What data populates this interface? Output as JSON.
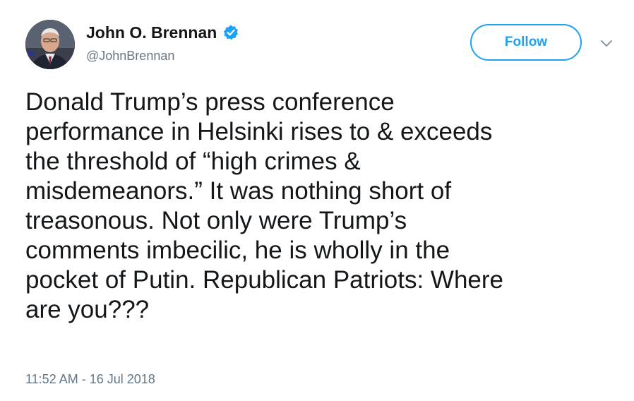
{
  "user": {
    "display_name": "John O. Brennan",
    "handle": "@JohnBrennan",
    "verified": true
  },
  "actions": {
    "follow_label": "Follow"
  },
  "tweet": {
    "lines": [
      "Donald Trump’s press conference",
      "performance in Helsinki rises to & exceeds",
      "the threshold of “high crimes &",
      "misdemeanors.” It was nothing short of",
      "treasonous. Not only were Trump’s",
      "comments imbecilic, he is wholly in the",
      "pocket of Putin. Republican Patriots: Where",
      "are you???"
    ],
    "timestamp": "11:52 AM - 16 Jul 2018"
  },
  "colors": {
    "accent": "#1da1f2",
    "text": "#14171a",
    "secondary": "#657786"
  },
  "icons": {
    "verified": "verified-badge-icon",
    "menu": "chevron-down-icon"
  }
}
